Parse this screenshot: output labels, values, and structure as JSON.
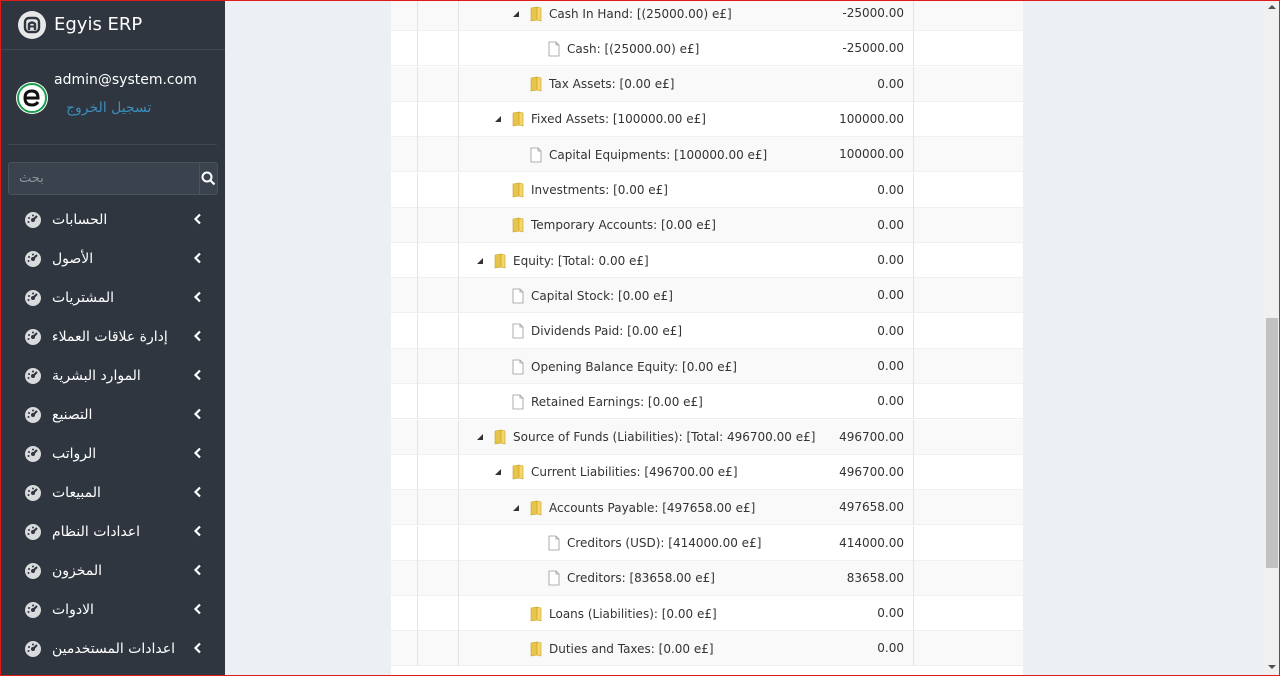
{
  "app": {
    "title": "Egyis ERP"
  },
  "user": {
    "email": "admin@system.com",
    "logout_label": "تسجيل الخروج"
  },
  "search": {
    "placeholder": "بحث"
  },
  "sidebar": {
    "items": [
      {
        "label": "الحسابات"
      },
      {
        "label": "الأصول"
      },
      {
        "label": "المشتريات"
      },
      {
        "label": "إدارة علاقات العملاء"
      },
      {
        "label": "الموارد البشرية"
      },
      {
        "label": "التصنيع"
      },
      {
        "label": "الرواتب"
      },
      {
        "label": "المبيعات"
      },
      {
        "label": "اعدادات النظام"
      },
      {
        "label": "المخزون"
      },
      {
        "label": "الادوات"
      },
      {
        "label": "اعدادات المستخدمين"
      }
    ]
  },
  "tree": {
    "rows": [
      {
        "label": "Cash In Hand: [(25000.00) e£]",
        "amount": "-25000.00",
        "type": "folder",
        "level": 3,
        "expanded": true
      },
      {
        "label": "Cash: [(25000.00) e£]",
        "amount": "-25000.00",
        "type": "file",
        "level": 4
      },
      {
        "label": "Tax Assets: [0.00 e£]",
        "amount": "0.00",
        "type": "folder",
        "level": 3
      },
      {
        "label": "Fixed Assets: [100000.00 e£]",
        "amount": "100000.00",
        "type": "folder",
        "level": 2,
        "expanded": true
      },
      {
        "label": "Capital Equipments: [100000.00 e£]",
        "amount": "100000.00",
        "type": "file",
        "level": 3
      },
      {
        "label": "Investments: [0.00 e£]",
        "amount": "0.00",
        "type": "folder",
        "level": 2
      },
      {
        "label": "Temporary Accounts: [0.00 e£]",
        "amount": "0.00",
        "type": "folder",
        "level": 2
      },
      {
        "label": "Equity: [Total: 0.00 e£]",
        "amount": "0.00",
        "type": "folder",
        "level": 1,
        "expanded": true
      },
      {
        "label": "Capital Stock: [0.00 e£]",
        "amount": "0.00",
        "type": "file",
        "level": 2
      },
      {
        "label": "Dividends Paid: [0.00 e£]",
        "amount": "0.00",
        "type": "file",
        "level": 2
      },
      {
        "label": "Opening Balance Equity: [0.00 e£]",
        "amount": "0.00",
        "type": "file",
        "level": 2
      },
      {
        "label": "Retained Earnings: [0.00 e£]",
        "amount": "0.00",
        "type": "file",
        "level": 2
      },
      {
        "label": "Source of Funds (Liabilities): [Total: 496700.00 e£]",
        "amount": "496700.00",
        "type": "folder",
        "level": 1,
        "expanded": true
      },
      {
        "label": "Current Liabilities: [496700.00 e£]",
        "amount": "496700.00",
        "type": "folder",
        "level": 2,
        "expanded": true
      },
      {
        "label": "Accounts Payable: [497658.00 e£]",
        "amount": "497658.00",
        "type": "folder",
        "level": 3,
        "expanded": true
      },
      {
        "label": "Creditors (USD): [414000.00 e£]",
        "amount": "414000.00",
        "type": "file",
        "level": 4
      },
      {
        "label": "Creditors: [83658.00 e£]",
        "amount": "83658.00",
        "type": "file",
        "level": 4
      },
      {
        "label": "Loans (Liabilities): [0.00 e£]",
        "amount": "0.00",
        "type": "folder",
        "level": 3
      },
      {
        "label": "Duties and Taxes: [0.00 e£]",
        "amount": "0.00",
        "type": "folder",
        "level": 3
      }
    ]
  },
  "colors": {
    "sidebar_bg": "#2f3640",
    "link": "#3c8dbc",
    "folder": "#e8c44a",
    "background": "#ecf0f5"
  }
}
